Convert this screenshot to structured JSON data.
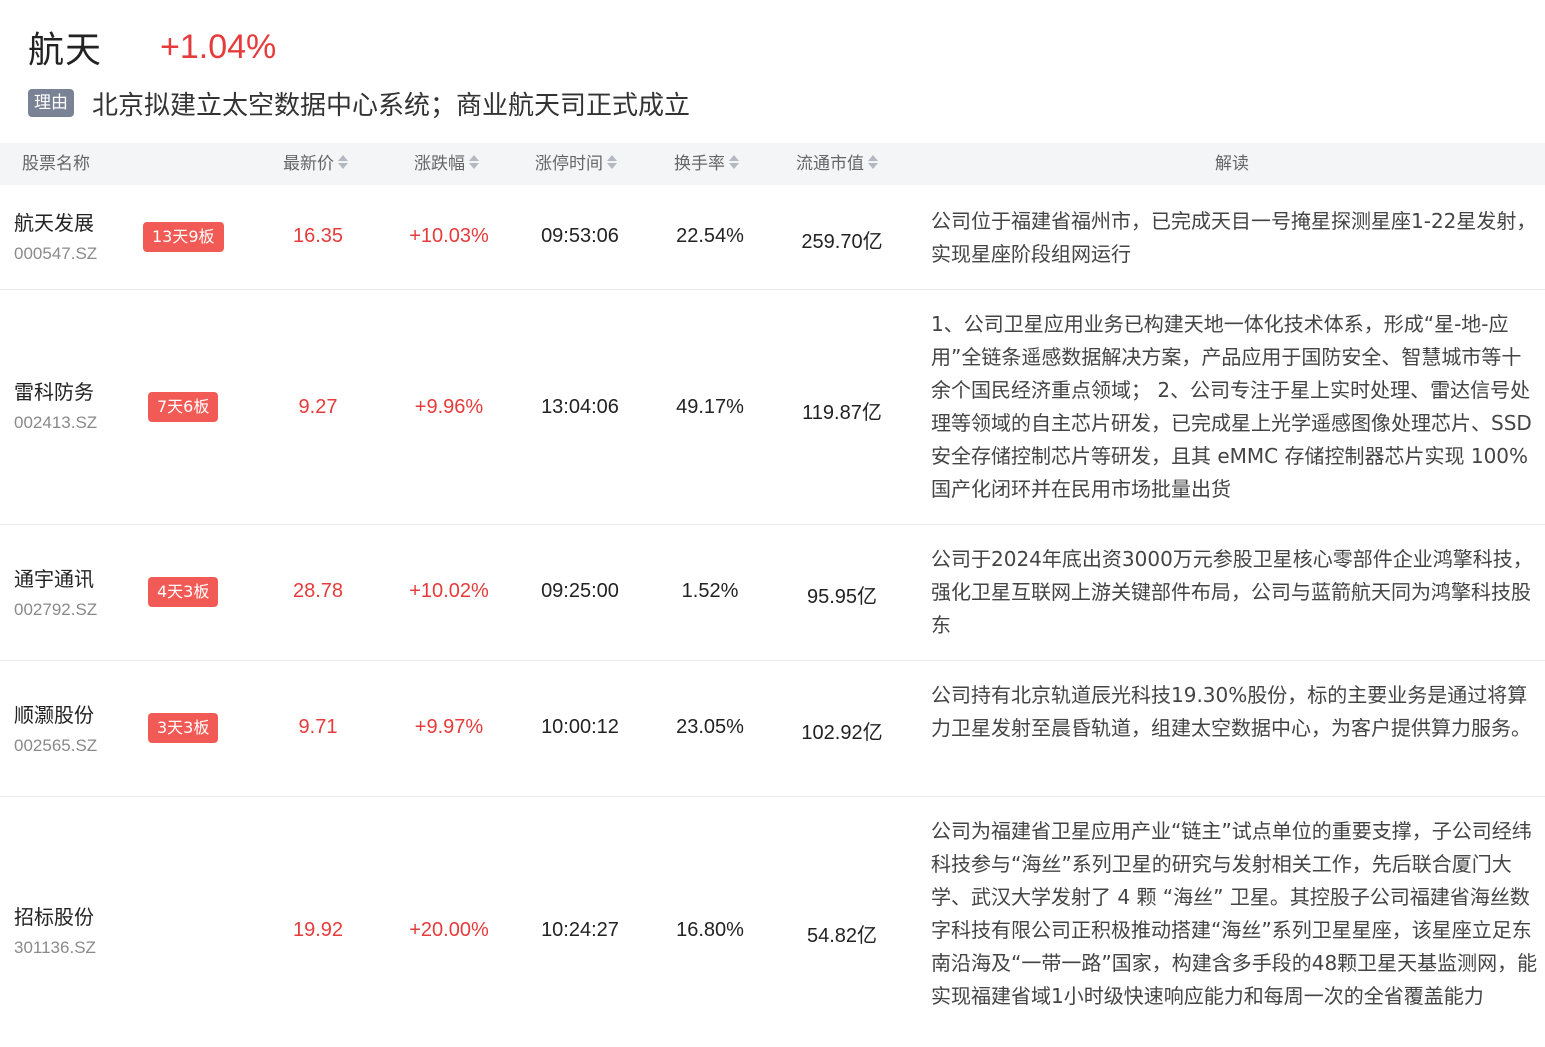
{
  "sector": {
    "name": "航天",
    "change": "+1.04%",
    "reason_tag": "理由",
    "reason_text": "北京拟建立太空数据中心系统；商业航天司正式成立"
  },
  "columns": {
    "name": "股票名称",
    "price": "最新价",
    "change": "涨跌幅",
    "limit_time": "涨停时间",
    "turnover": "换手率",
    "market_cap": "流通市值",
    "description": "解读"
  },
  "colors": {
    "rise": "#e63b3b",
    "badge": "#f25a55",
    "reason_tag": "#7a8295",
    "header_bg": "#f4f5f7"
  },
  "rows": [
    {
      "name": "航天发展",
      "code": "000547.SZ",
      "badge": "13天9板",
      "price": "16.35",
      "change": "+10.03%",
      "limit_time": "09:53:06",
      "turnover": "22.54%",
      "market_cap": "259.70亿",
      "description": "公司位于福建省福州市，已完成天目一号掩星探测星座1-22星发射，实现星座阶段组网运行"
    },
    {
      "name": "雷科防务",
      "code": "002413.SZ",
      "badge": "7天6板",
      "price": "9.27",
      "change": "+9.96%",
      "limit_time": "13:04:06",
      "turnover": "49.17%",
      "market_cap": "119.87亿",
      "description": "1、公司卫星应用业务已构建天地一体化技术体系，形成“星-地-应用”全链条遥感数据解决方案，产品应用于国防安全、智慧城市等十余个国民经济重点领域； 2、公司专注于星上实时处理、雷达信号处理等领域的自主芯片研发，已完成星上光学遥感图像处理芯片、SSD 安全存储控制芯片等研发，且其 eMMC 存储控制器芯片实现 100% 国产化闭环并在民用市场批量出货"
    },
    {
      "name": "通宇通讯",
      "code": "002792.SZ",
      "badge": "4天3板",
      "price": "28.78",
      "change": "+10.02%",
      "limit_time": "09:25:00",
      "turnover": "1.52%",
      "market_cap": "95.95亿",
      "description": "公司于2024年底出资3000万元参股卫星核心零部件企业鸿擎科技，强化卫星互联网上游关键部件布局，公司与蓝箭航天同为鸿擎科技股东"
    },
    {
      "name": "顺灏股份",
      "code": "002565.SZ",
      "badge": "3天3板",
      "price": "9.71",
      "change": "+9.97%",
      "limit_time": "10:00:12",
      "turnover": "23.05%",
      "market_cap": "102.92亿",
      "description": "公司持有北京轨道辰光科技19.30%股份，标的主要业务是通过将算力卫星发射至晨昏轨道，组建太空数据中心，为客户提供算力服务。"
    },
    {
      "name": "招标股份",
      "code": "301136.SZ",
      "badge": "",
      "price": "19.92",
      "change": "+20.00%",
      "limit_time": "10:24:27",
      "turnover": "16.80%",
      "market_cap": "54.82亿",
      "description": "公司为福建省卫星应用产业“链主”试点单位的重要支撑，子公司经纬科技参与“海丝”系列卫星的研究与发射相关工作，先后联合厦门大学、武汉大学发射了 4 颗 “海丝” 卫星。其控股子公司福建省海丝数字科技有限公司正积极推动搭建“海丝”系列卫星星座，该星座立足东南沿海及“一带一路”国家，构建含多手段的48颗卫星天基监测网，能实现福建省域1小时级快速响应能力和每周一次的全省覆盖能力"
    }
  ]
}
